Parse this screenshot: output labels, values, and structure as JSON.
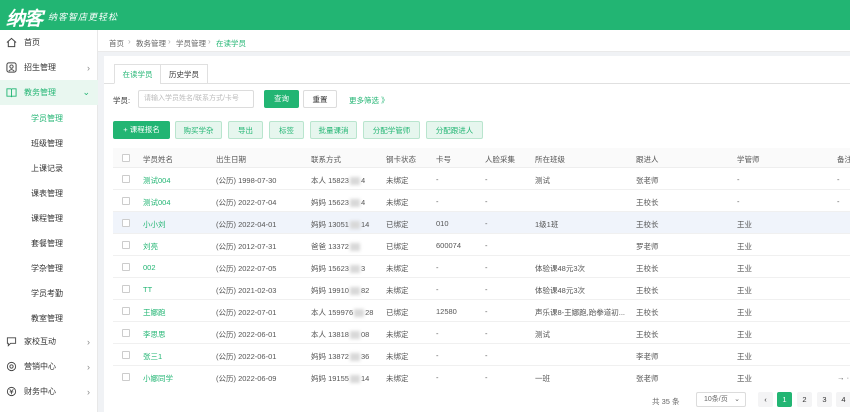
{
  "header": {
    "logo": "纳客",
    "slogan": "纳客智店更轻松"
  },
  "sidebar": {
    "items": [
      {
        "label": "首页",
        "icon": "home-icon",
        "arrow": ""
      },
      {
        "label": "招生管理",
        "icon": "user-card-icon",
        "arrow": "›"
      },
      {
        "label": "教务管理",
        "icon": "book-icon",
        "arrow": "⌄"
      }
    ],
    "sub": [
      "学员管理",
      "班级管理",
      "上课记录",
      "课表管理",
      "课程管理",
      "套餐管理",
      "学杂管理",
      "学员考勤",
      "教室管理"
    ],
    "bottom": [
      {
        "label": "家校互动",
        "icon": "chat-icon",
        "arrow": "›"
      },
      {
        "label": "营销中心",
        "icon": "megaphone-icon",
        "arrow": "›"
      },
      {
        "label": "财务中心",
        "icon": "money-icon",
        "arrow": "›"
      }
    ]
  },
  "breadcrumb": [
    "首页",
    "教务管理",
    "学员管理",
    "在读学员"
  ],
  "tabs": [
    "在读学员",
    "历史学员"
  ],
  "search": {
    "label": "学员:",
    "placeholder": "请输入学员姓名/联系方式/卡号",
    "query": "查询",
    "reset": "重置",
    "more": "更多筛选 》"
  },
  "actions": {
    "enroll": "+ 课程报名",
    "buy": "购买学杂",
    "export": "导出",
    "tag": "标签",
    "batch": "批量课消",
    "assign_teacher": "分配学管师",
    "assign_follow": "分配跟进人"
  },
  "table": {
    "headers": [
      "学员姓名",
      "出生日期",
      "联系方式",
      "钢卡状态",
      "卡号",
      "人脸采集",
      "所在班级",
      "跟进人",
      "学管师",
      "备注"
    ],
    "rows": [
      {
        "name": "测试004",
        "birth": "(公历) 1998-07-30",
        "contact_a": "本人 15823",
        "contact_b": "4",
        "card_status": "未绑定",
        "card": "-",
        "face": "-",
        "klass": "测试",
        "follow": "张老师",
        "teacher": "-",
        "note": "-"
      },
      {
        "name": "测试004",
        "birth": "(公历) 2022-07-04",
        "contact_a": "妈妈 15623",
        "contact_b": "4",
        "card_status": "未绑定",
        "card": "-",
        "face": "-",
        "klass": "",
        "follow": "王校长",
        "teacher": "-",
        "note": "-"
      },
      {
        "name": "小小刘",
        "birth": "(公历) 2022-04-01",
        "contact_a": "妈妈 13051",
        "contact_b": "14",
        "card_status": "已绑定",
        "card": "010",
        "face": "-",
        "klass": "1级1班",
        "follow": "王校长",
        "teacher": "王业",
        "note": ""
      },
      {
        "name": "刘亮",
        "birth": "(公历) 2012-07-31",
        "contact_a": "爸爸 13372",
        "contact_b": "",
        "card_status": "已绑定",
        "card": "600074",
        "face": "-",
        "klass": "",
        "follow": "罗老师",
        "teacher": "王业",
        "note": ""
      },
      {
        "name": "002",
        "birth": "(公历) 2022-07-05",
        "contact_a": "妈妈 15623",
        "contact_b": "3",
        "card_status": "未绑定",
        "card": "-",
        "face": "-",
        "klass": "体验课48元3次",
        "follow": "王校长",
        "teacher": "王业",
        "note": ""
      },
      {
        "name": "TT",
        "birth": "(公历) 2021-02-03",
        "contact_a": "妈妈 19910",
        "contact_b": "82",
        "card_status": "未绑定",
        "card": "-",
        "face": "-",
        "klass": "体验课48元3次",
        "follow": "王校长",
        "teacher": "王业",
        "note": ""
      },
      {
        "name": "王娜跑",
        "birth": "(公历) 2022-07-01",
        "contact_a": "本人 159976",
        "contact_b": "28",
        "card_status": "已绑定",
        "card": "12580",
        "face": "-",
        "klass": "声乐课8-王娜跑,跆拳道初...",
        "follow": "王校长",
        "teacher": "王业",
        "note": ""
      },
      {
        "name": "李思思",
        "birth": "(公历) 2022-06-01",
        "contact_a": "本人 13818",
        "contact_b": "08",
        "card_status": "未绑定",
        "card": "-",
        "face": "-",
        "klass": "测试",
        "follow": "王校长",
        "teacher": "王业",
        "note": ""
      },
      {
        "name": "张三1",
        "birth": "(公历) 2022-06-01",
        "contact_a": "妈妈 13872",
        "contact_b": "36",
        "card_status": "未绑定",
        "card": "-",
        "face": "-",
        "klass": "",
        "follow": "李老师",
        "teacher": "王业",
        "note": ""
      },
      {
        "name": "小娜同学",
        "birth": "(公历) 2022-06-09",
        "contact_a": "妈妈 19155",
        "contact_b": "14",
        "card_status": "未绑定",
        "card": "-",
        "face": "-",
        "klass": "一班",
        "follow": "张老师",
        "teacher": "王业",
        "note": "→ ·"
      }
    ]
  },
  "pager": {
    "total": "共 35 条",
    "size": "10条/页",
    "prev": "‹",
    "pages": [
      "1",
      "2",
      "3",
      "4"
    ]
  }
}
